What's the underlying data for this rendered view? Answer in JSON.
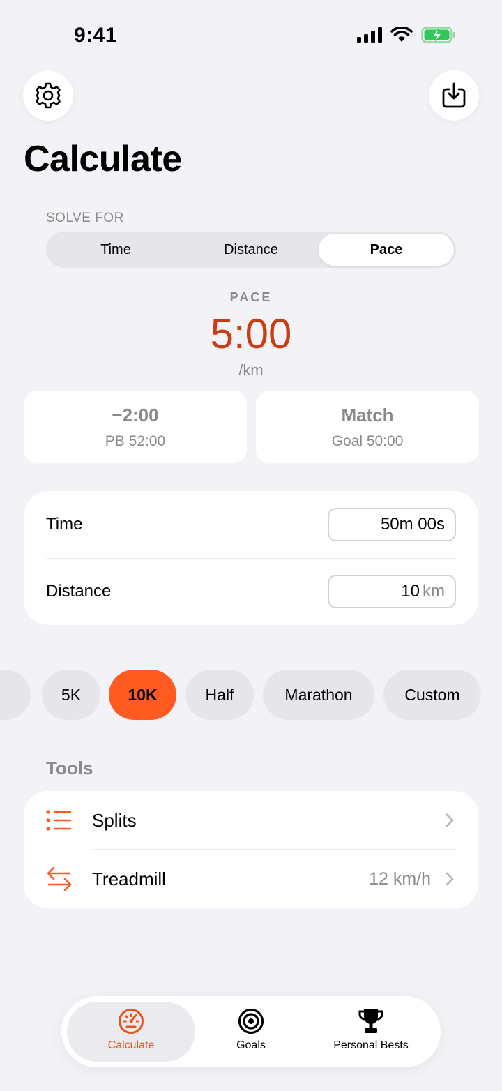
{
  "status_bar": {
    "time": "9:41"
  },
  "header": {
    "title": "Calculate"
  },
  "solve_for": {
    "caption": "SOLVE FOR",
    "options": [
      "Time",
      "Distance",
      "Pace"
    ],
    "selected": "Pace"
  },
  "result": {
    "label": "PACE",
    "value": "5:00",
    "unit": "/km"
  },
  "comparisons": [
    {
      "main": "−2:00",
      "sub": "PB 52:00"
    },
    {
      "main": "Match",
      "sub": "Goal 50:00"
    }
  ],
  "inputs": {
    "time": {
      "label": "Time",
      "value": "50m 00s"
    },
    "distance": {
      "label": "Distance",
      "value": "10",
      "unit": "km"
    }
  },
  "distance_chips": {
    "items": [
      "5K",
      "10K",
      "Half",
      "Marathon",
      "Custom"
    ],
    "selected": "10K"
  },
  "tools": {
    "heading": "Tools",
    "items": [
      {
        "label": "Splits",
        "value": "",
        "icon": "list-icon"
      },
      {
        "label": "Treadmill",
        "value": "12 km/h",
        "icon": "arrows-swap-icon"
      }
    ]
  },
  "tab_bar": {
    "tabs": [
      {
        "label": "Calculate",
        "icon": "speedometer-icon"
      },
      {
        "label": "Goals",
        "icon": "target-icon"
      },
      {
        "label": "Personal Bests",
        "icon": "trophy-icon"
      }
    ],
    "selected": "Calculate"
  },
  "colors": {
    "accent": "#ff5a1f",
    "result": "#c93d15",
    "background": "#f2f2f7",
    "battery": "#34c759"
  }
}
